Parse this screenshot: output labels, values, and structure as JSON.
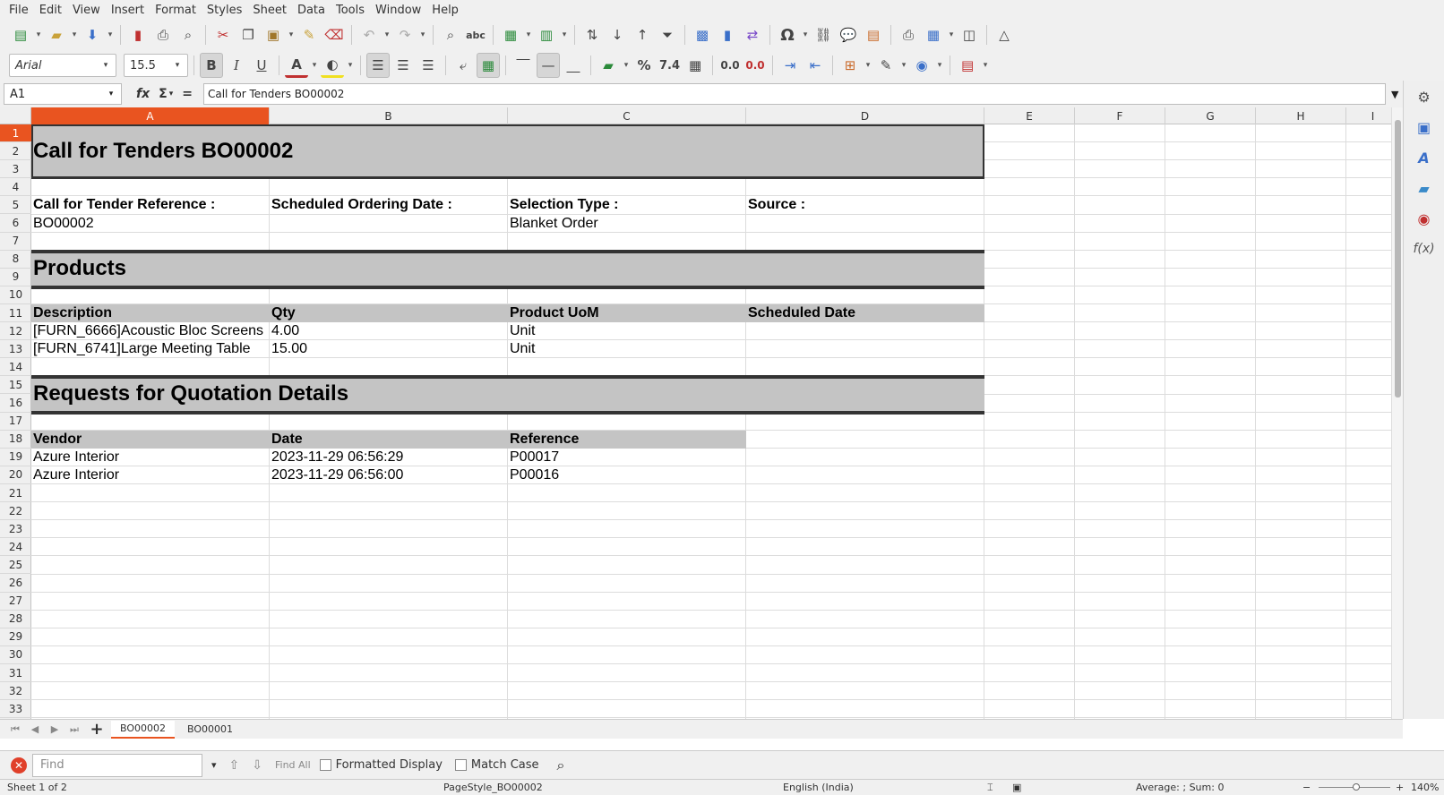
{
  "menubar": [
    "File",
    "Edit",
    "View",
    "Insert",
    "Format",
    "Styles",
    "Sheet",
    "Data",
    "Tools",
    "Window",
    "Help"
  ],
  "toolbar": {
    "font_name": "Arial",
    "font_size": "15.5",
    "bold": "B",
    "italic": "I",
    "underline": "U",
    "percent": "%",
    "number_format": "7.4",
    "add_decimal": "0.0",
    "del_decimal": "0.0",
    "omega": "Ω",
    "font_color": "A"
  },
  "formula_bar": {
    "cell_ref": "A1",
    "fx": "fx",
    "sigma": "Σ",
    "equals": "=",
    "content": "Call for Tenders BO00002"
  },
  "columns": [
    "A",
    "B",
    "C",
    "D",
    "E",
    "F",
    "G",
    "H",
    "I"
  ],
  "rows": [
    "1",
    "2",
    "3",
    "4",
    "5",
    "6",
    "7",
    "8",
    "9",
    "10",
    "11",
    "12",
    "13",
    "14",
    "15",
    "16",
    "17",
    "18",
    "19",
    "20",
    "21",
    "22",
    "23",
    "24",
    "25",
    "26",
    "27",
    "28",
    "29",
    "30",
    "31",
    "32",
    "33"
  ],
  "sheet": {
    "title": "Call for Tenders BO00002",
    "info_headers": [
      "Call for Tender Reference :",
      "Scheduled Ordering Date :",
      "Selection Type :",
      "Source :"
    ],
    "info_values": [
      "BO00002",
      "",
      "Blanket Order",
      ""
    ],
    "products_title": "Products",
    "product_headers": [
      "Description",
      "Qty",
      "Product UoM",
      "Scheduled Date"
    ],
    "products": [
      [
        "[FURN_6666]Acoustic Bloc Screens",
        "4.00",
        "Unit",
        ""
      ],
      [
        "[FURN_6741]Large Meeting Table",
        "15.00",
        "Unit",
        ""
      ]
    ],
    "rfq_title": "Requests for Quotation Details",
    "rfq_headers": [
      "Vendor",
      "Date",
      "Reference"
    ],
    "rfqs": [
      [
        "Azure Interior",
        "2023-11-29 06:56:29",
        "P00017"
      ],
      [
        "Azure Interior",
        "2023-11-29 06:56:00",
        "P00016"
      ]
    ]
  },
  "tabs": [
    "BO00002",
    "BO00001"
  ],
  "findbar": {
    "placeholder": "Find",
    "find_all": "Find All",
    "formatted_display": "Formatted Display",
    "match_case": "Match Case"
  },
  "status": {
    "sheet": "Sheet 1 of 2",
    "page_style": "PageStyle_BO00002",
    "language": "English (India)",
    "summary": "Average: ; Sum: 0",
    "zoom": "140%",
    "zoom_minus": "−",
    "zoom_plus": "+"
  }
}
